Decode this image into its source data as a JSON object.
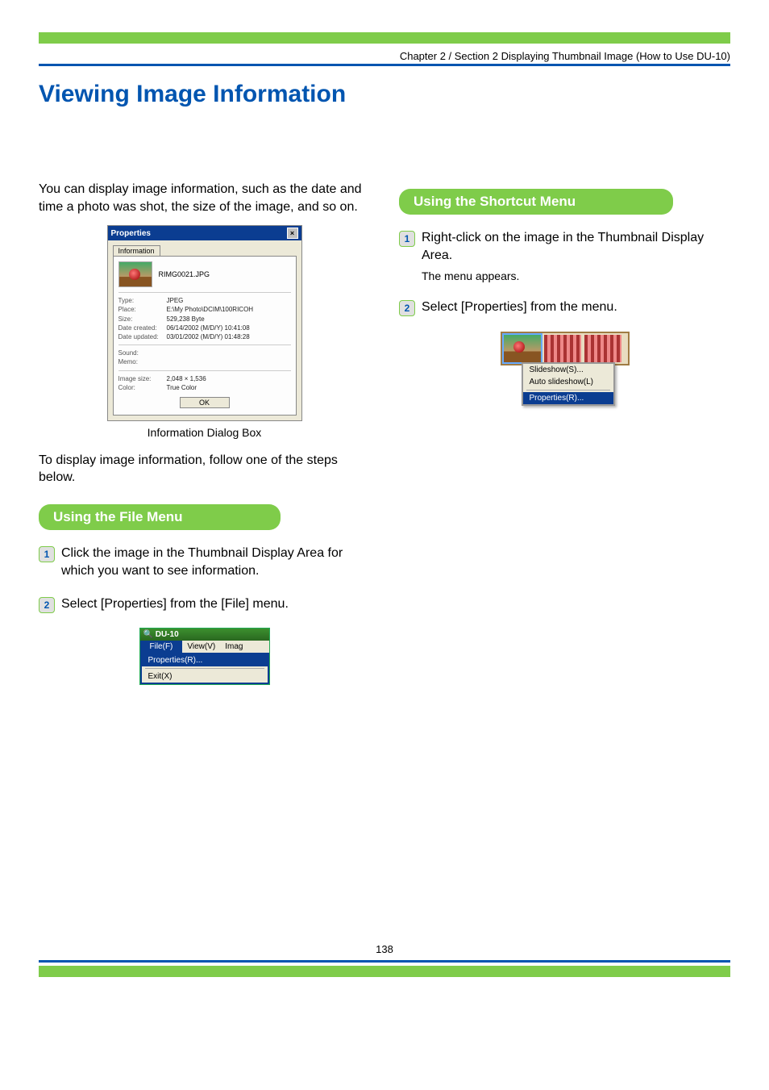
{
  "chapter_line": "Chapter 2 / Section 2  Displaying Thumbnail Image (How to Use DU-10)",
  "title": "Viewing Image Information",
  "intro": "You can display image information, such as the date and time a photo was shot, the size of the image, and so on.",
  "properties_dialog": {
    "titlebar": "Properties",
    "tab": "Information",
    "filename": "RIMG0021.JPG",
    "rows": [
      {
        "k": "Type:",
        "v": "JPEG"
      },
      {
        "k": "Place:",
        "v": "E:\\My Photo\\DCIM\\100RICOH"
      },
      {
        "k": "Size:",
        "v": "529,238 Byte"
      },
      {
        "k": "Date created:",
        "v": "06/14/2002 (M/D/Y) 10:41:08"
      },
      {
        "k": "Date updated:",
        "v": "03/01/2002 (M/D/Y) 01:48:28"
      }
    ],
    "rows2": [
      {
        "k": "Sound:",
        "v": ""
      },
      {
        "k": "Memo:",
        "v": ""
      }
    ],
    "rows3": [
      {
        "k": "Image size:",
        "v": "2,048 × 1,536"
      },
      {
        "k": "Color:",
        "v": "True Color"
      }
    ],
    "ok": "OK",
    "caption": "Information Dialog Box"
  },
  "follow_intro": "To display image information, follow one of the steps below.",
  "file_menu_section": {
    "heading": "Using the File Menu",
    "step1": "Click the image in the Thumbnail Display Area for which you want to see information.",
    "step2": "Select [Properties] from the [File] menu.",
    "window_title": "DU-10",
    "menubar": {
      "file": "File(F)",
      "view": "View(V)",
      "image": "Imag"
    },
    "dropdown": {
      "properties": "Properties(R)...",
      "exit": "Exit(X)"
    }
  },
  "shortcut_section": {
    "heading": "Using the Shortcut Menu",
    "step1": "Right-click on the image in the Thumbnail Display Area.",
    "step1_sub": "The menu appears.",
    "step2": "Select [Properties] from the menu.",
    "context_menu": {
      "slideshow": "Slideshow(S)...",
      "auto": "Auto slideshow(L)",
      "properties": "Properties(R)..."
    }
  },
  "page_number": "138"
}
